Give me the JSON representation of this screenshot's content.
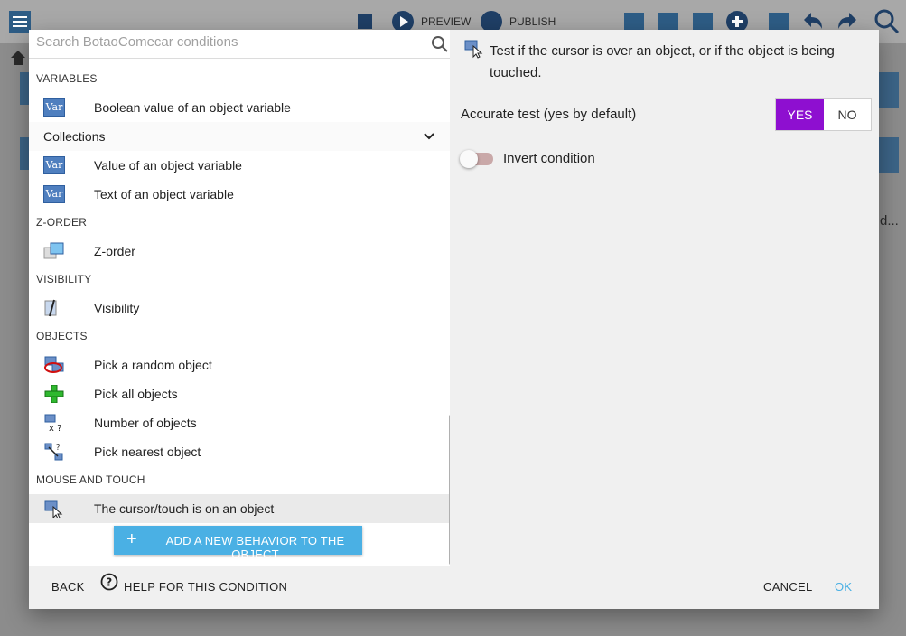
{
  "background": {
    "preview_label": "PREVIEW",
    "publish_label": "PUBLISH",
    "truncated_text": "d..."
  },
  "search": {
    "placeholder": "Search BotaoComecar conditions"
  },
  "list": {
    "sections": [
      {
        "title": "VARIABLES"
      },
      {
        "title": "Z-ORDER"
      },
      {
        "title": "VISIBILITY"
      },
      {
        "title": "OBJECTS"
      },
      {
        "title": "MOUSE AND TOUCH"
      }
    ],
    "items": [
      {
        "label": "Boolean value of an object variable",
        "icon": "var-icon"
      },
      {
        "label": "Value of an object variable",
        "icon": "var-icon"
      },
      {
        "label": "Text of an object variable",
        "icon": "var-icon"
      },
      {
        "label": "Z-order",
        "icon": "z-order-icon"
      },
      {
        "label": "Visibility",
        "icon": "visibility-icon"
      },
      {
        "label": "Pick a random object",
        "icon": "pick-random-icon"
      },
      {
        "label": "Pick all objects",
        "icon": "pick-all-icon"
      },
      {
        "label": "Number of objects",
        "icon": "number-objects-icon"
      },
      {
        "label": "Pick nearest object",
        "icon": "pick-nearest-icon"
      },
      {
        "label": "The cursor/touch is on an object",
        "icon": "cursor-on-object-icon",
        "selected": true
      }
    ],
    "group": {
      "label": "Collections"
    },
    "icon_text": "Var",
    "add_behavior_label": "ADD A NEW BEHAVIOR TO THE OBJECT"
  },
  "details": {
    "description": "Test if the cursor is over an object, or if the object is being touched.",
    "accurate_label": "Accurate test (yes by default)",
    "yes_label": "YES",
    "no_label": "NO",
    "yes_selected": true,
    "invert_label": "Invert condition",
    "invert_on": false
  },
  "footer": {
    "back_label": "BACK",
    "help_label": "HELP FOR THIS CONDITION",
    "cancel_label": "CANCEL",
    "ok_label": "OK"
  },
  "colors": {
    "accent": "#8e0fd0",
    "primary": "#4ab0e4"
  }
}
